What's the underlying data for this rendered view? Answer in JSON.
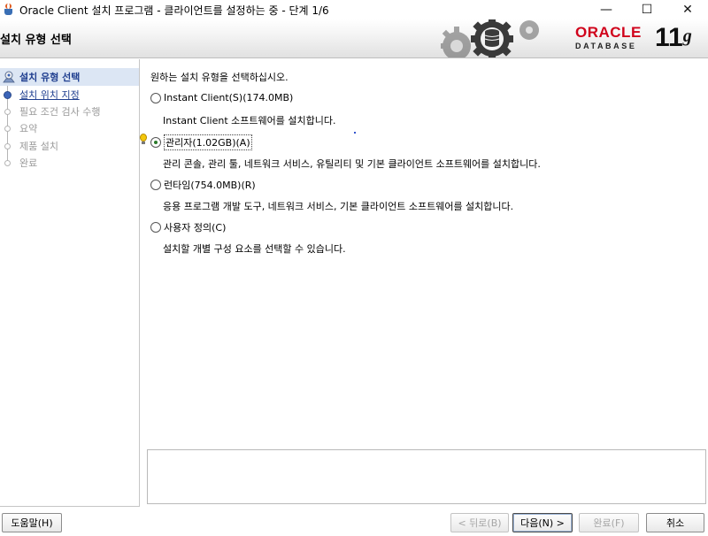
{
  "window": {
    "title": "Oracle Client 설치 프로그램 - 클라이언트를 설정하는 중 - 단계 1/6",
    "minimize": "—",
    "maximize": "☐",
    "close": "✕"
  },
  "banner": {
    "page_title": "설치 유형 선택",
    "logo_oracle": "ORACLE",
    "logo_database": "DATABASE",
    "logo_version": "11",
    "logo_version_suffix": "g"
  },
  "sidebar": {
    "steps": [
      {
        "label": "설치 유형 선택",
        "state": "current"
      },
      {
        "label": "설치 위치 지정",
        "state": "link"
      },
      {
        "label": "필요 조건 검사 수행",
        "state": "disabled"
      },
      {
        "label": "요약",
        "state": "disabled"
      },
      {
        "label": "제품 설치",
        "state": "disabled"
      },
      {
        "label": "완료",
        "state": "disabled"
      }
    ]
  },
  "main": {
    "prompt": "원하는 설치 유형을 선택하십시오.",
    "options": [
      {
        "label": "Instant Client(S)(174.0MB)",
        "description": "Instant Client 소프트웨어를 설치합니다.",
        "selected": false
      },
      {
        "label": "관리자(1.02GB)(A)",
        "description": "관리 콘솔, 관리 툴, 네트워크 서비스, 유틸리티 및 기본 클라이언트 소프트웨어를 설치합니다.",
        "selected": true
      },
      {
        "label": "런타임(754.0MB)(R)",
        "description": "응용 프로그램 개발 도구, 네트워크 서비스, 기본 클라이언트 소프트웨어를 설치합니다.",
        "selected": false
      },
      {
        "label": "사용자 정의(C)",
        "description": "설치할 개별 구성 요소를 선택할 수 있습니다.",
        "selected": false
      }
    ]
  },
  "buttons": {
    "help": "도움말(H)",
    "back": "< 뒤로(B)",
    "next": "다음(N) >",
    "finish": "완료(F)",
    "cancel": "취소"
  },
  "colors": {
    "accent_link": "#1f3e8f",
    "oracle_red": "#d0021b",
    "selection_bg": "#dce6f4"
  }
}
